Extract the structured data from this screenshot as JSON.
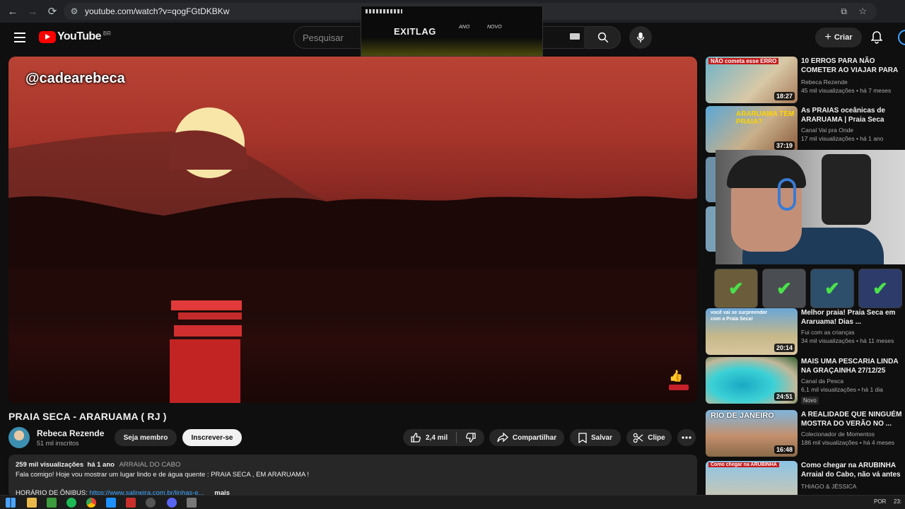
{
  "browser": {
    "url": "youtube.com/watch?v=qogFGtDKBKw"
  },
  "header": {
    "logo": "YouTube",
    "country": "BR",
    "search_placeholder": "Pesquisar",
    "create_label": "Criar"
  },
  "overlay": {
    "brand": "EXITLAG",
    "word1": "ANO",
    "word2": "NOVO"
  },
  "video": {
    "handle": "@cadearebeca",
    "title": "PRAIA SECA - ARARUAMA ( RJ )"
  },
  "channel": {
    "name": "Rebeca Rezende",
    "subscribers": "51 mil inscritos",
    "member_label": "Seja membro",
    "subscribe_label": "Inscrever-se"
  },
  "actions": {
    "likes": "2,4 mil",
    "share": "Compartilhar",
    "save": "Salvar",
    "clip": "Clipe"
  },
  "description": {
    "views": "259 mil visualizações",
    "age": "há 1 ano",
    "location": "ARRAIAL DO CABO",
    "line1": "Fala comigo! Hoje vou mostrar um lugar lindo e de água quente : PRAIA SECA , EM ARARUAMA !",
    "line2_prefix": "HORÁRIO DE ÔNIBUS:",
    "line2_link": "https://www.salineira.com.br/linhas-e...",
    "more": "mais"
  },
  "recommendations": [
    {
      "title": "10 ERROS PARA NÃO COMETER AO VIAJAR PARA ARRAIAL DO CABO",
      "channel": "Rebeca Rezende",
      "views": "45 mil visualizações",
      "age": "há 7 meses",
      "duration": "18:27",
      "thumb_text": "NÃO cometa esse ERRO"
    },
    {
      "title": "As PRAIAS oceânicas de ARARUAMA | Praia Seca",
      "channel": "Canal Vai pra Onde",
      "views": "17 mil visualizações",
      "age": "há 1 ano",
      "duration": "37:19",
      "thumb_text": "ARARUAMA TEM PRAIA?"
    },
    {
      "title": "Melhor praia! Praia Seca em Araruama! Dias ...",
      "channel": "Fui com as crianças",
      "views": "34 mil visualizações",
      "age": "há 11 meses",
      "duration": "20:14",
      "thumb_text": "você vai se surpreender com a Praia Seca!"
    },
    {
      "title": "MAIS UMA PESCARIA LINDA NA GRAÇAINHA 27/12/25",
      "channel": "Canal da Pesca",
      "views": "6,1 mil visualizações",
      "age": "há 1 dia",
      "duration": "24:51",
      "badge": "Novo"
    },
    {
      "title": "A REALIDADE QUE NINGUÉM MOSTRA DO VERÃO NO ...",
      "channel": "Colecionador de Momentos",
      "views": "186 mil visualizações",
      "age": "há 4 meses",
      "duration": "16:48",
      "thumb_text": "RIO DE JANEIRO"
    },
    {
      "title": "Como chegar na ARUBINHA Arraial do Cabo, não vá antes ...",
      "channel": "THIAGO & JÉSSICA",
      "views": "",
      "age": "",
      "duration": "",
      "thumb_text": "Como chegar na ARUBINHA"
    }
  ],
  "taskbar": {
    "lang": "POR",
    "time": "23:"
  }
}
